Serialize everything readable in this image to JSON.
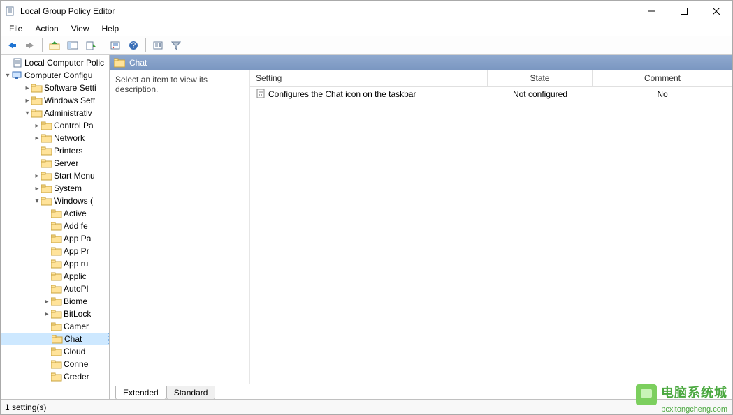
{
  "title": "Local Group Policy Editor",
  "menu": [
    "File",
    "Action",
    "View",
    "Help"
  ],
  "tree": {
    "root": "Local Computer Polic",
    "level1": {
      "label": "Computer Configu",
      "type": "computer"
    },
    "children": [
      {
        "indent": 2,
        "twisty": ">",
        "label": "Software Setti"
      },
      {
        "indent": 2,
        "twisty": ">",
        "label": "Windows Sett"
      },
      {
        "indent": 2,
        "twisty": "v",
        "label": "Administrativ"
      },
      {
        "indent": 3,
        "twisty": ">",
        "label": "Control Pa"
      },
      {
        "indent": 3,
        "twisty": ">",
        "label": "Network"
      },
      {
        "indent": 3,
        "twisty": "",
        "label": "Printers"
      },
      {
        "indent": 3,
        "twisty": "",
        "label": "Server"
      },
      {
        "indent": 3,
        "twisty": ">",
        "label": "Start Menu"
      },
      {
        "indent": 3,
        "twisty": ">",
        "label": "System"
      },
      {
        "indent": 3,
        "twisty": "v",
        "label": "Windows ("
      },
      {
        "indent": 4,
        "twisty": "",
        "label": "Active"
      },
      {
        "indent": 4,
        "twisty": "",
        "label": "Add fe"
      },
      {
        "indent": 4,
        "twisty": "",
        "label": "App Pa"
      },
      {
        "indent": 4,
        "twisty": "",
        "label": "App Pr"
      },
      {
        "indent": 4,
        "twisty": "",
        "label": "App ru"
      },
      {
        "indent": 4,
        "twisty": "",
        "label": "Applic"
      },
      {
        "indent": 4,
        "twisty": "",
        "label": "AutoPl"
      },
      {
        "indent": 4,
        "twisty": ">",
        "label": "Biome"
      },
      {
        "indent": 4,
        "twisty": ">",
        "label": "BitLock"
      },
      {
        "indent": 4,
        "twisty": "",
        "label": "Camer"
      },
      {
        "indent": 4,
        "twisty": "",
        "label": "Chat",
        "selected": true
      },
      {
        "indent": 4,
        "twisty": "",
        "label": "Cloud"
      },
      {
        "indent": 4,
        "twisty": "",
        "label": "Conne"
      },
      {
        "indent": 4,
        "twisty": "",
        "label": "Creder"
      }
    ]
  },
  "details": {
    "header": "Chat",
    "description": "Select an item to view its description.",
    "columns": {
      "setting": "Setting",
      "state": "State",
      "comment": "Comment"
    },
    "rows": [
      {
        "setting": "Configures the Chat icon on the taskbar",
        "state": "Not configured",
        "comment": "No"
      }
    ]
  },
  "tabs": {
    "extended": "Extended",
    "standard": "Standard",
    "active": "extended"
  },
  "status": "1 setting(s)",
  "watermark": {
    "line1": "电脑系统城",
    "line2": "pcxitongcheng.com"
  }
}
